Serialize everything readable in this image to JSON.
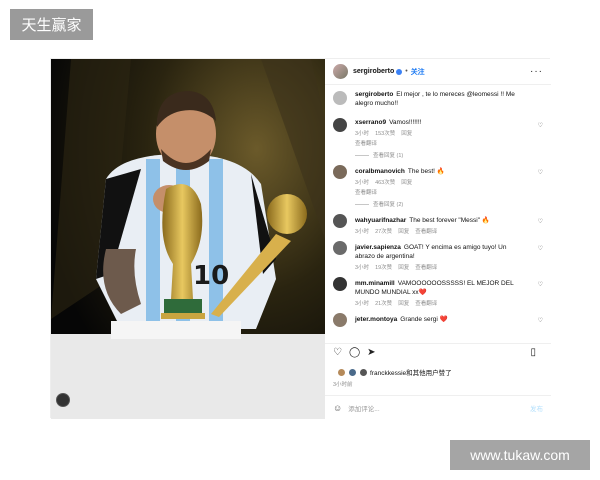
{
  "watermarks": {
    "top": "天生赢家",
    "bottom": "www.tukaw.com"
  },
  "post": {
    "author": "sergiroberto",
    "follow_label": "关注",
    "caption_user": "sergiroberto",
    "caption_text": "El mejor , te lo mereces @leomessi !! Me alegro mucho!!",
    "comments": [
      {
        "user": "xserrano9",
        "text": "Vamos!!!!!!!",
        "time": "3小时",
        "likes": "153次赞",
        "reply": "回复",
        "translate": "查看翻译",
        "replies": "查看回复 (1)"
      },
      {
        "user": "coralbmanovich",
        "text": "The best! 🔥",
        "time": "3小时",
        "likes": "463次赞",
        "reply": "回复",
        "translate": "查看翻译",
        "replies": "查看回复 (2)"
      },
      {
        "user": "wahyuarifnazhar",
        "text": "The best forever \"Messi\" 🔥",
        "time": "3小时",
        "likes": "27次赞",
        "reply": "回复",
        "translate": "查看翻译",
        "replies": ""
      },
      {
        "user": "javier.sapienza",
        "text": "GOAT! Y encima es amigo tuyo! Un abrazo de argentina!",
        "time": "3小时",
        "likes": "19次赞",
        "reply": "回复",
        "translate": "查看翻译",
        "replies": ""
      },
      {
        "user": "mm.minamill",
        "text": "VAMOOOOOOSSSSS! EL MEJOR DEL MUNDO MUNDIAL xx❤️",
        "time": "3小时",
        "likes": "21次赞",
        "reply": "回复",
        "translate": "查看翻译",
        "replies": ""
      },
      {
        "user": "jeter.montoya",
        "text": "Grande sergi ❤️",
        "time": "",
        "likes": "",
        "reply": "",
        "translate": "",
        "replies": ""
      }
    ],
    "liked_by": "franckkessie和其他用户赞了",
    "posted_time": "3小时前",
    "add_comment_placeholder": "添加评论...",
    "post_label": "发布"
  },
  "icons": {
    "heart": "heart-icon",
    "comment": "comment-icon",
    "share": "share-icon",
    "bookmark": "bookmark-icon",
    "emoji": "emoji-icon",
    "more": "more-icon",
    "verified": "verified-icon"
  },
  "colors": {
    "accent": "#1877f2",
    "muted": "#8e8e8e",
    "photo_bg": "#0b0b0b"
  }
}
